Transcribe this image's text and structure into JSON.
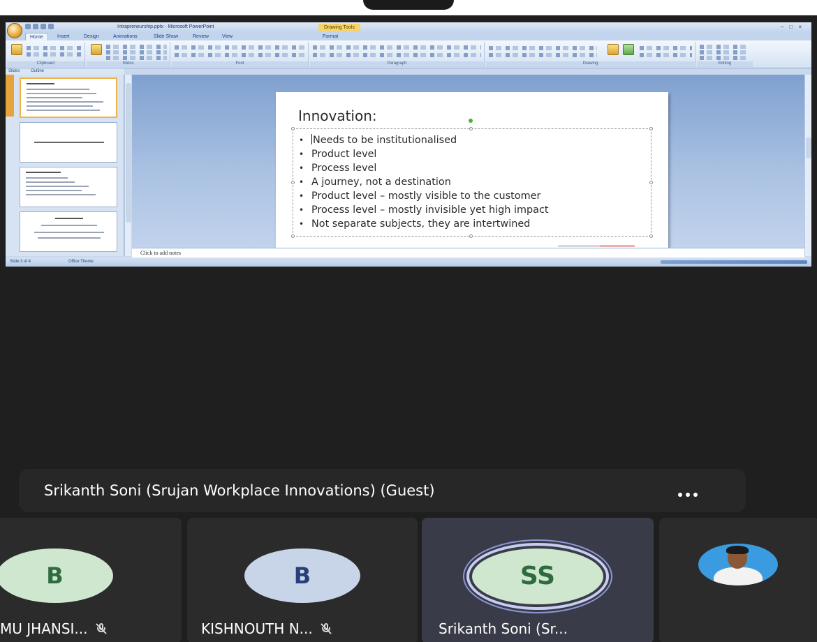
{
  "app": {
    "document_title": "Intrapreneurship.pptx - Microsoft PowerPoint",
    "contextual_tab": "Drawing Tools",
    "ribbon_tabs": [
      "Home",
      "Insert",
      "Design",
      "Animations",
      "Slide Show",
      "Review",
      "View",
      "Format"
    ],
    "ribbon_groups": [
      "Clipboard",
      "Slides",
      "Font",
      "Paragraph",
      "Drawing",
      "Editing"
    ],
    "panel_tabs": [
      "Slides",
      "Outline"
    ],
    "notes_placeholder": "Click to add notes",
    "status_slide": "Slide 3 of 4",
    "status_theme": "Office Theme"
  },
  "slide": {
    "title": "Innovation:",
    "bullets": [
      "Needs to be institutionalised",
      "Product level",
      "Process level",
      "A journey, not a destination",
      "Product level – mostly visible to the customer",
      "Process level – mostly invisible yet high impact",
      "Not separate subjects, they are intertwined"
    ]
  },
  "meeting": {
    "presenter_label": "Srikanth Soni (Srujan Workplace Innovations) (Guest)",
    "participants": [
      {
        "initials": "B",
        "name": "MU JHANSI...",
        "avatar_bg": "#cfe6cf",
        "avatar_fg": "#2e6b3e",
        "muted": true,
        "speaking": false
      },
      {
        "initials": "B",
        "name": "KISHNOUTH N...",
        "avatar_bg": "#c8d4e8",
        "avatar_fg": "#27407a",
        "muted": true,
        "speaking": false
      },
      {
        "initials": "SS",
        "name": "Srikanth Soni (Sr...",
        "avatar_bg": "#cfe6cf",
        "avatar_fg": "#2e6b3e",
        "muted": false,
        "speaking": true
      },
      {
        "initials": "",
        "name": "",
        "avatar_bg": "#3a9be0",
        "muted": false,
        "speaking": false,
        "photo": true
      }
    ]
  },
  "colors": {
    "meeting_background": "#1f1f1f",
    "speaking_ring": "#c9cdf2"
  }
}
